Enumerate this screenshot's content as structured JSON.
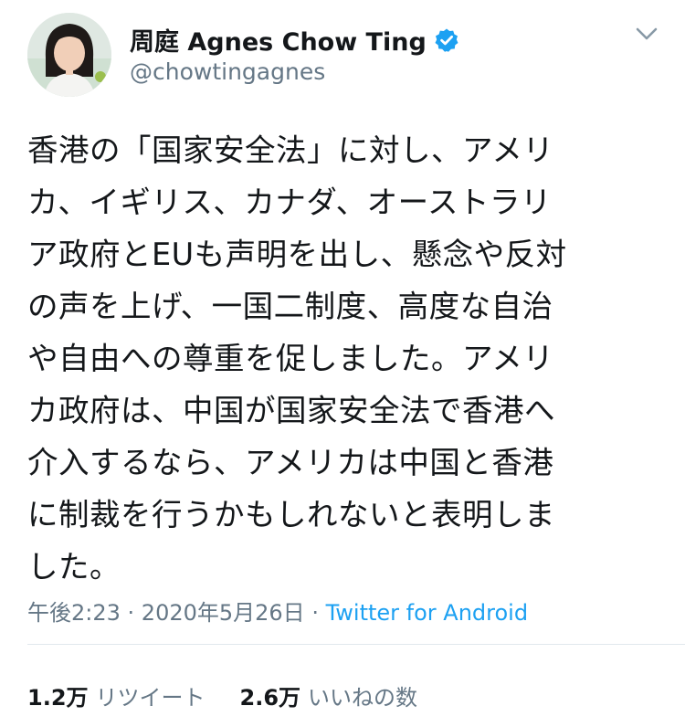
{
  "author": {
    "display_name": "周庭 Agnes Chow Ting",
    "handle": "@chowtingagnes",
    "verified": true,
    "verified_color": "#1da1f2",
    "avatar": "avatar-photo"
  },
  "tweet": {
    "text": "香港の「国家安全法」に対し、アメリ\nカ、イギリス、カナダ、オーストラリ\nア政府とEUも声明を出し、懸念や反対\nの声を上げ、一国二制度、高度な自治\nや自由への尊重を促しました。アメリ\nカ政府は、中国が国家安全法で香港へ\n介入するなら、アメリカは中国と香港\nに制裁を行うかもしれないと表明しま\nした。"
  },
  "meta": {
    "time": "午後2:23",
    "sep1": " · ",
    "date": "2020年5月26日",
    "sep2": " · ",
    "source": "Twitter for Android"
  },
  "stats": {
    "retweets_count": "1.2万",
    "retweets_label": "リツイート",
    "likes_count": "2.6万",
    "likes_label": "いいねの数"
  },
  "icons": {
    "menu": "chevron-down-icon",
    "verified": "verified-badge-icon"
  },
  "colors": {
    "text": "#14171a",
    "secondary": "#657786",
    "link": "#1da1f2",
    "divider": "#e1e8ed"
  }
}
